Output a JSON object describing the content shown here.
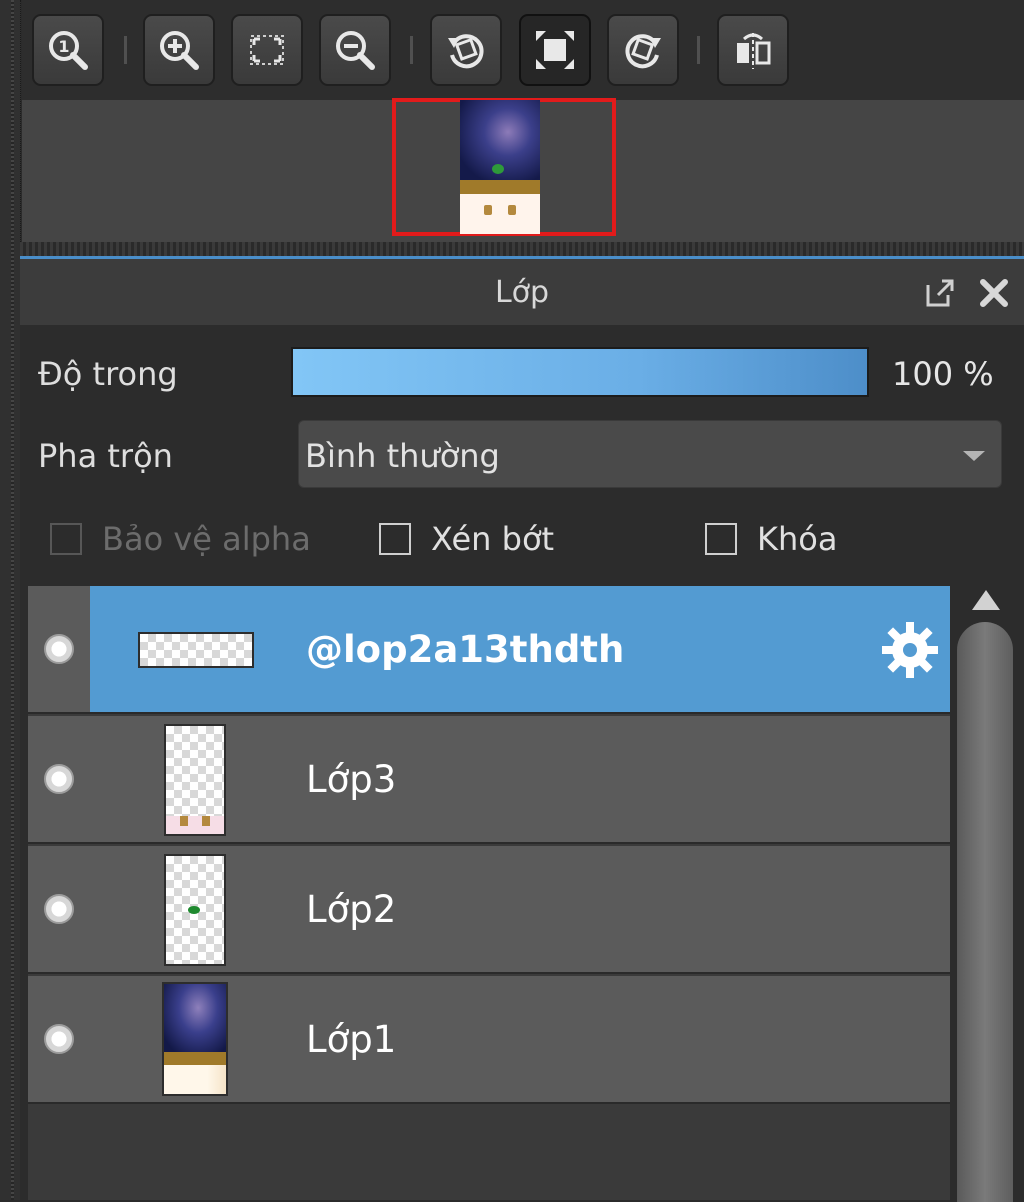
{
  "toolbar": {
    "buttons": [
      {
        "name": "zoom-actual-size",
        "icon": "zoom-one-icon"
      },
      {
        "name": "zoom-in",
        "icon": "zoom-in-icon"
      },
      {
        "name": "fit-to-window",
        "icon": "fit-screen-icon"
      },
      {
        "name": "zoom-out",
        "icon": "zoom-out-icon"
      },
      {
        "name": "rotate-left",
        "icon": "rotate-left-icon"
      },
      {
        "name": "reset-rotation",
        "icon": "fullscreen-icon",
        "active": true
      },
      {
        "name": "rotate-right",
        "icon": "rotate-right-icon"
      },
      {
        "name": "flip-horizontal",
        "icon": "flip-horizontal-icon"
      }
    ]
  },
  "panel": {
    "title": "Lớp",
    "icons": [
      "popout-icon",
      "close-icon"
    ]
  },
  "opacity": {
    "label": "Độ trong",
    "value": 100,
    "value_text": "100 %"
  },
  "blend": {
    "label": "Pha trộn",
    "selected": "Bình thường"
  },
  "options": {
    "protect_alpha": {
      "label": "Bảo vệ alpha",
      "checked": false,
      "enabled": false
    },
    "clip": {
      "label": "Xén bớt",
      "checked": false,
      "enabled": true
    },
    "lock": {
      "label": "Khóa",
      "checked": false,
      "enabled": true
    }
  },
  "layers": [
    {
      "name": "@lop2a13thdth",
      "selected": true,
      "visible": true,
      "thumb": "wide-transparent",
      "icon": "gear-icon"
    },
    {
      "name": "Lớp3",
      "selected": false,
      "visible": true,
      "thumb": "face-transparent"
    },
    {
      "name": "Lớp2",
      "selected": false,
      "visible": true,
      "thumb": "leaf-transparent"
    },
    {
      "name": "Lớp1",
      "selected": false,
      "visible": true,
      "thumb": "galaxy-background"
    }
  ],
  "colors": {
    "selection": "#539bd2",
    "navigator_frame": "#e21b1b",
    "opacity_fill": "#6aaee6"
  }
}
